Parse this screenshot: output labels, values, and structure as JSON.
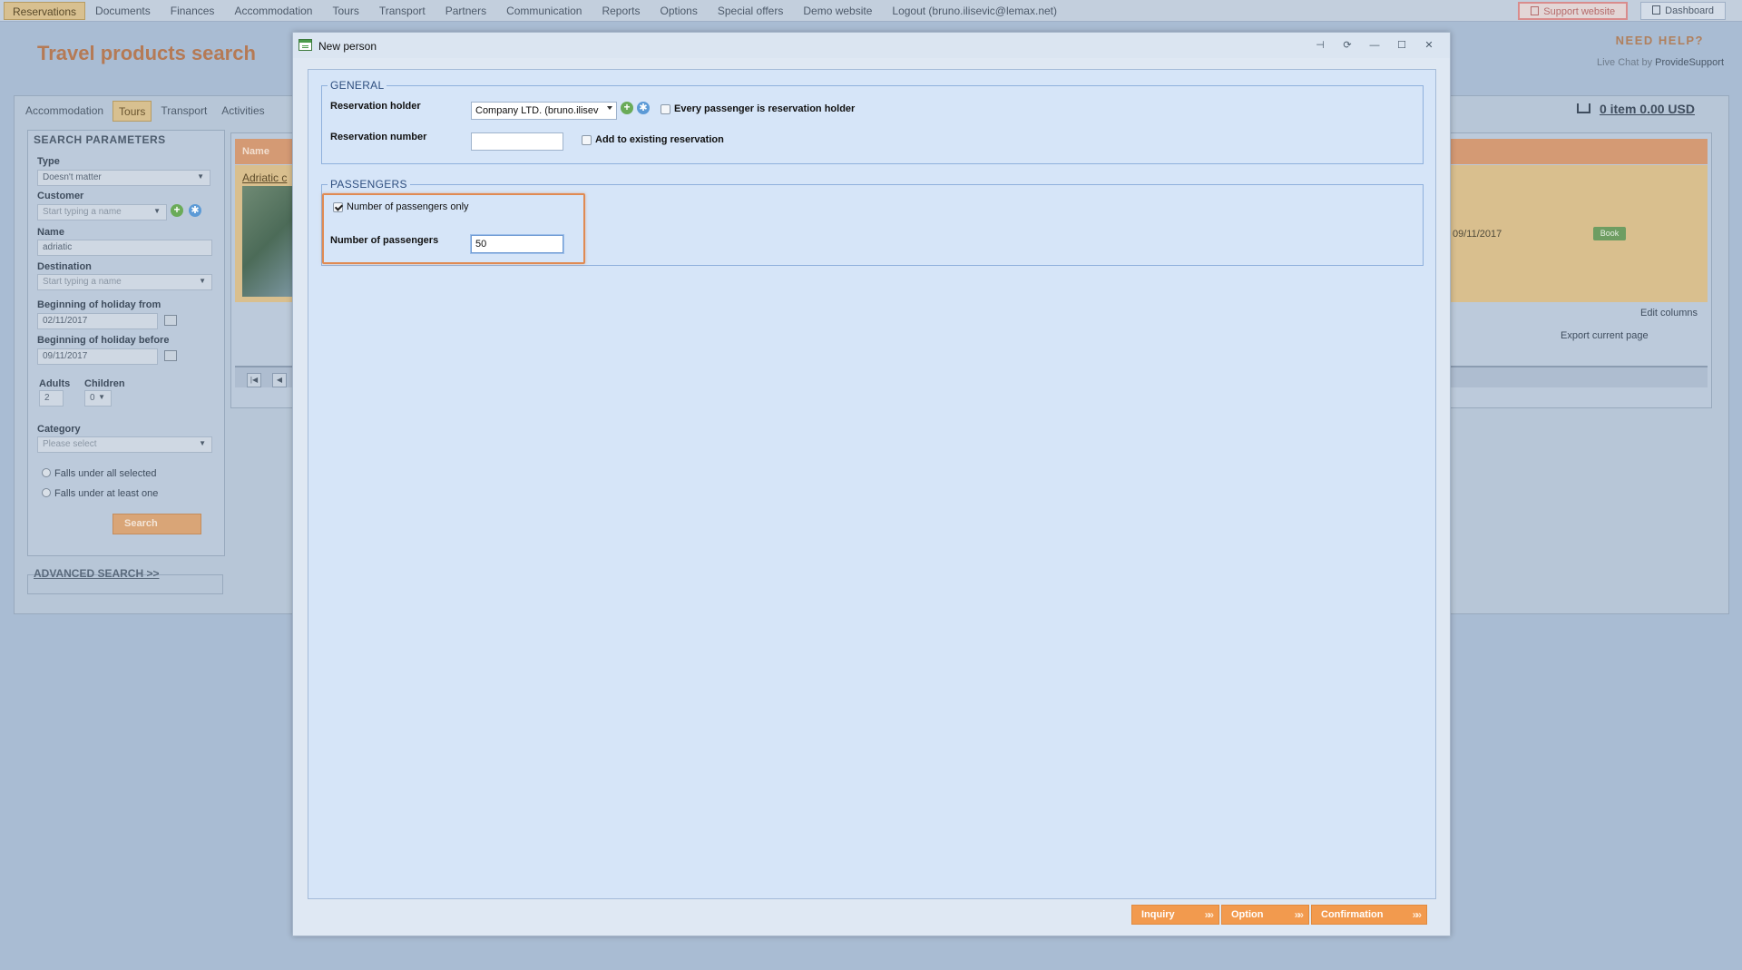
{
  "topmenu": {
    "items": [
      "Reservations",
      "Documents",
      "Finances",
      "Accommodation",
      "Tours",
      "Transport",
      "Partners",
      "Communication",
      "Reports",
      "Options",
      "Special offers",
      "Demo website",
      "Logout (bruno.ilisevic@lemax.net)"
    ],
    "support_label": "Support website",
    "dashboard_label": "Dashboard"
  },
  "page": {
    "title": "Travel products search",
    "need_help": "NEED HELP?",
    "live_chat_prefix": "Live Chat by",
    "live_chat_brand": "ProvideSupport",
    "tabs": [
      "Accommodation",
      "Tours",
      "Transport",
      "Activities"
    ],
    "cart": "0 item 0.00 USD"
  },
  "search": {
    "title": "SEARCH PARAMETERS",
    "type_label": "Type",
    "type_value": "Doesn't matter",
    "customer_label": "Customer",
    "customer_placeholder": "Start typing a name",
    "name_label": "Name",
    "name_value": "adriatic",
    "destination_label": "Destination",
    "destination_placeholder": "Start typing a name",
    "from_label": "Beginning of holiday from",
    "from_value": "02/11/2017",
    "before_label": "Beginning of holiday before",
    "before_value": "09/11/2017",
    "adults_label": "Adults",
    "adults_value": "2",
    "children_label": "Children",
    "children_value": "0",
    "category_label": "Category",
    "category_placeholder": "Please select",
    "radio_all": "Falls under all selected",
    "radio_one": "Falls under at least one",
    "search_btn": "Search",
    "advanced": "ADVANCED SEARCH >>"
  },
  "results": {
    "col_name": "Name",
    "first_name": "Adriatic c",
    "date": "09/11/2017",
    "book": "Book",
    "edit_columns": "Edit columns",
    "export_page": "Export current page"
  },
  "modal": {
    "title": "New person",
    "general_legend": "GENERAL",
    "holder_label": "Reservation holder",
    "holder_value": "Company LTD. (bruno.ilisev",
    "every_passenger_label": "Every passenger is reservation holder",
    "resnum_label": "Reservation number",
    "resnum_value": "",
    "add_existing_label": "Add to existing reservation",
    "passengers_legend": "PASSENGERS",
    "pax_only_label": "Number of passengers only",
    "pax_count_label": "Number of passengers",
    "pax_count_value": "50",
    "btn_inquiry": "Inquiry",
    "btn_option": "Option",
    "btn_confirmation": "Confirmation"
  }
}
